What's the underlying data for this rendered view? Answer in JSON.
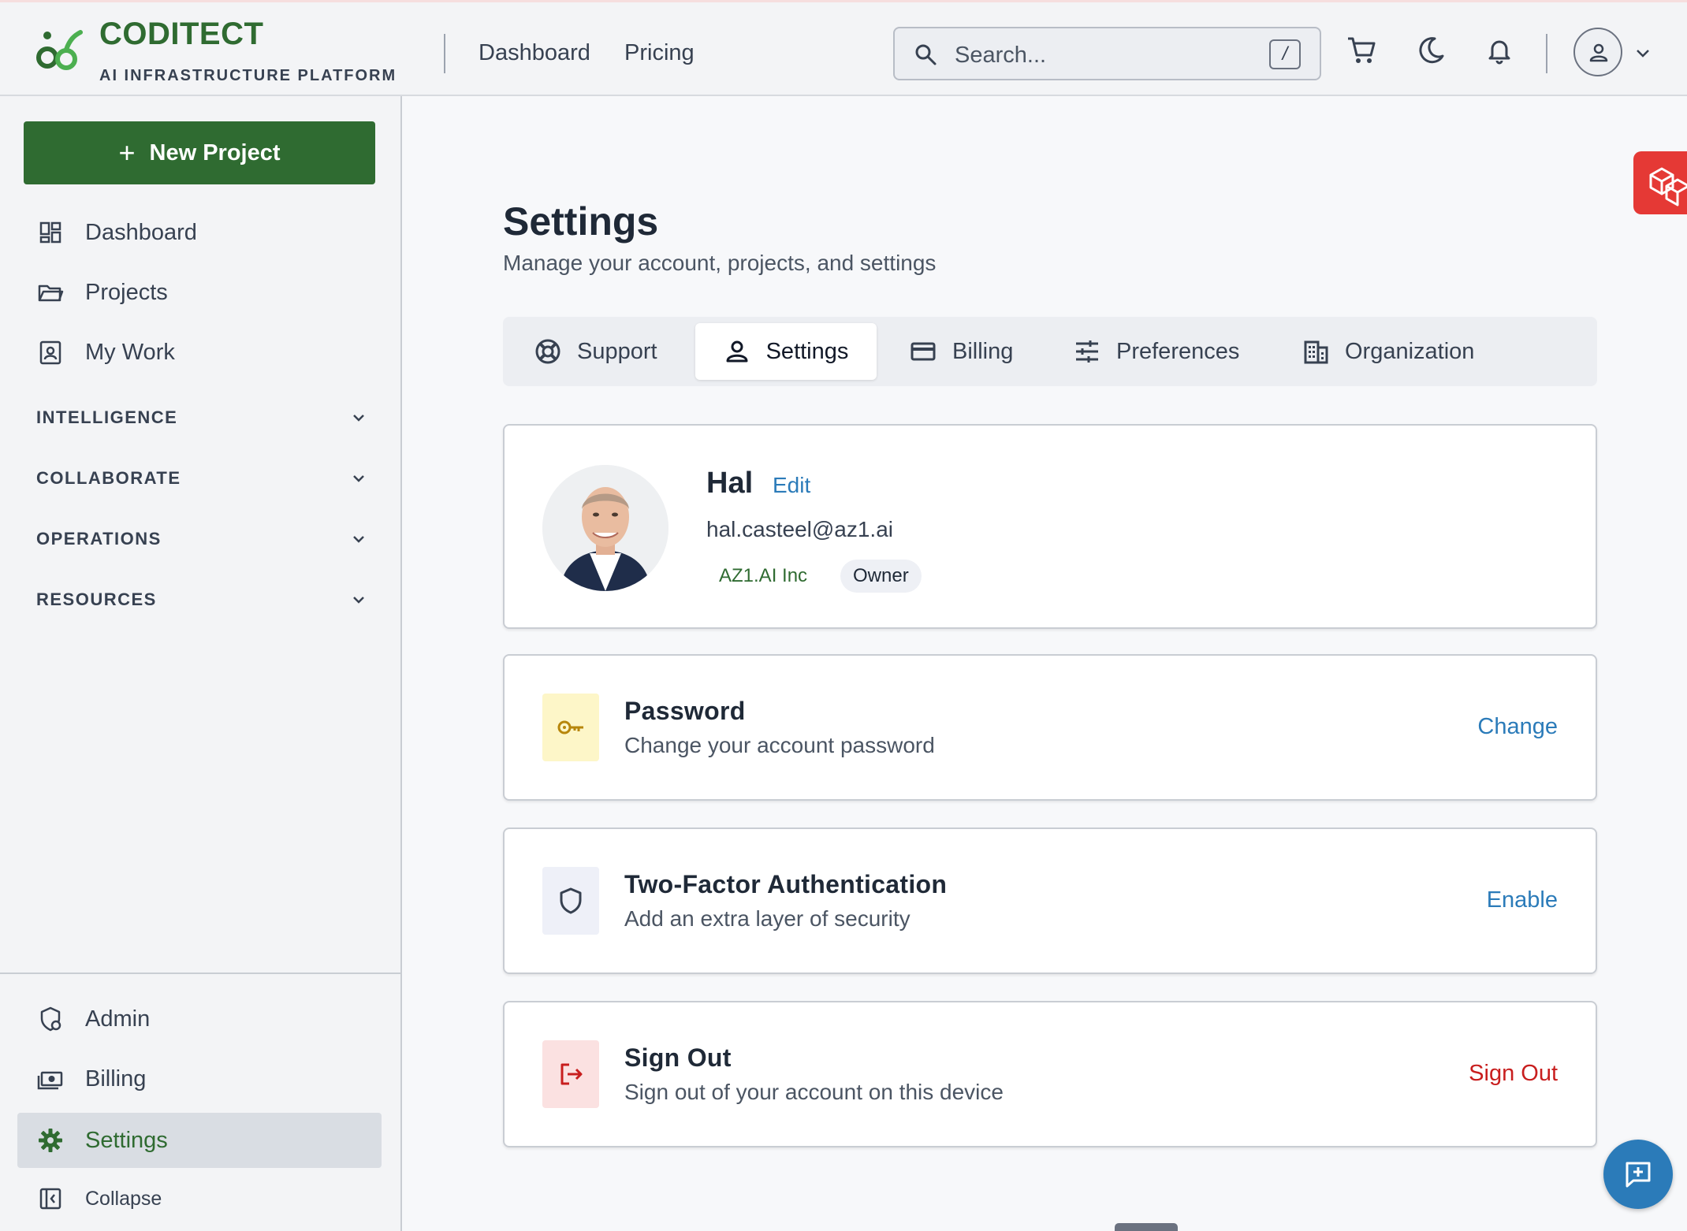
{
  "brand": {
    "name": "CODITECT",
    "tagline": "AI INFRASTRUCTURE PLATFORM",
    "accent": "#2f6b31"
  },
  "topnav": {
    "links": [
      "Dashboard",
      "Pricing"
    ]
  },
  "search": {
    "placeholder": "Search...",
    "shortcut": "/"
  },
  "header_icons": [
    "cart-icon",
    "moon-icon",
    "bell-icon",
    "user-icon"
  ],
  "sidebar": {
    "new_project": "New Project",
    "items": [
      {
        "label": "Dashboard",
        "icon": "dashboard-icon"
      },
      {
        "label": "Projects",
        "icon": "folder-icon"
      },
      {
        "label": "My Work",
        "icon": "id-badge-icon"
      }
    ],
    "sections": [
      "INTELLIGENCE",
      "COLLABORATE",
      "OPERATIONS",
      "RESOURCES"
    ],
    "bottom_items": [
      {
        "label": "Admin",
        "icon": "admin-icon"
      },
      {
        "label": "Billing",
        "icon": "money-icon"
      },
      {
        "label": "Settings",
        "icon": "gear-icon"
      },
      {
        "label": "Collapse",
        "icon": "collapse-icon"
      }
    ]
  },
  "page": {
    "title": "Settings",
    "subtitle": "Manage your account, projects, and settings"
  },
  "tabs": [
    "Support",
    "Settings",
    "Billing",
    "Preferences",
    "Organization"
  ],
  "active_tab": "Settings",
  "profile": {
    "name": "Hal",
    "edit_label": "Edit",
    "email": "hal.casteel@az1.ai",
    "org": "AZ1.AI Inc",
    "role": "Owner"
  },
  "security_rows": [
    {
      "title": "Password",
      "description": "Change your account password",
      "action": "Change",
      "icon": "key-icon"
    },
    {
      "title": "Two-Factor Authentication",
      "description": "Add an extra layer of security",
      "action": "Enable",
      "icon": "shield-icon"
    },
    {
      "title": "Sign Out",
      "description": "Sign out of your account on this device",
      "action": "Sign Out",
      "icon": "logout-icon"
    }
  ]
}
